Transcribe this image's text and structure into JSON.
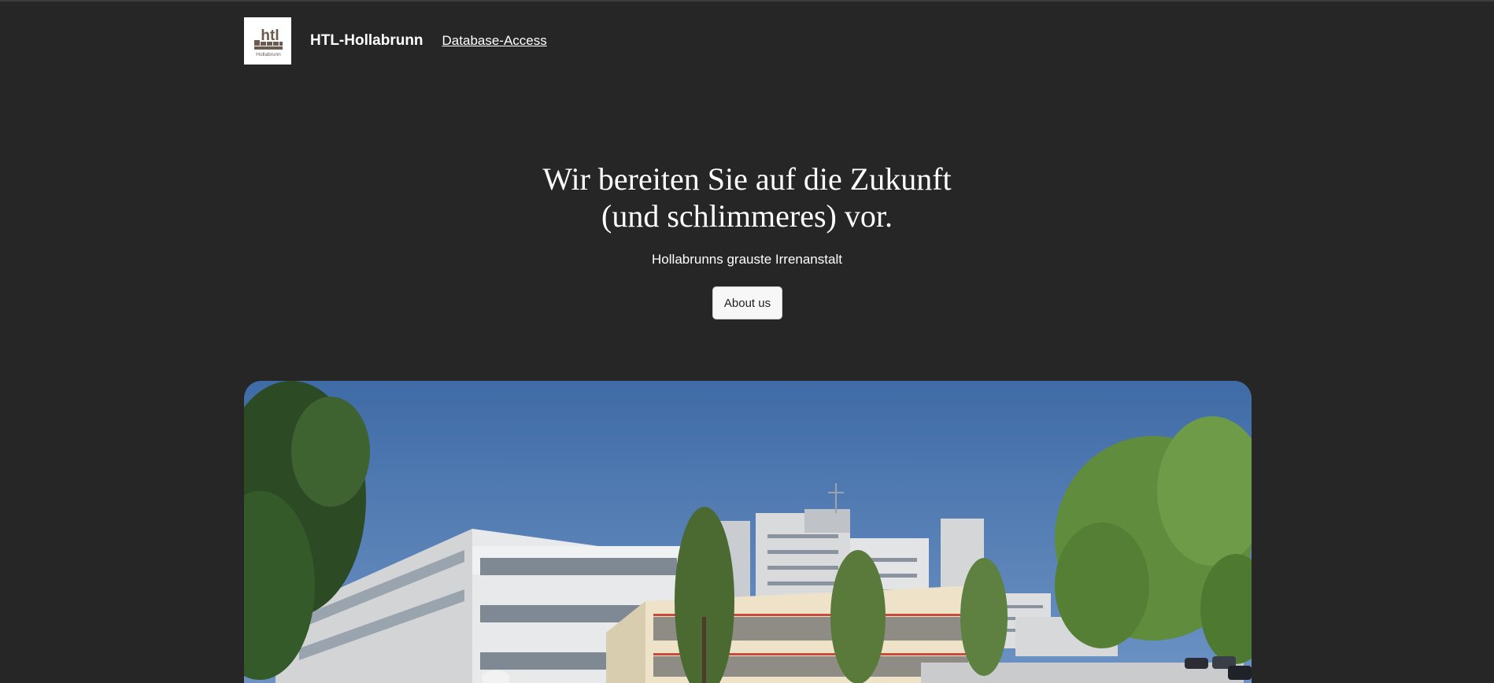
{
  "header": {
    "logo_text_top": "htl",
    "logo_text_bottom": "Hollabrunn",
    "brand": "HTL-Hollabrunn",
    "nav_link": "Database-Access"
  },
  "hero": {
    "title_line1": "Wir bereiten Sie auf die Zukunft",
    "title_line2": "(und schlimmeres) vor.",
    "subtitle": "Hollabrunns grauste Irrenanstalt",
    "button_label": "About us"
  },
  "colors": {
    "background": "#262626",
    "logo_brown": "#6b5a4e",
    "sky": "#4a74ad"
  },
  "image": {
    "subject": "school-building-photo"
  }
}
